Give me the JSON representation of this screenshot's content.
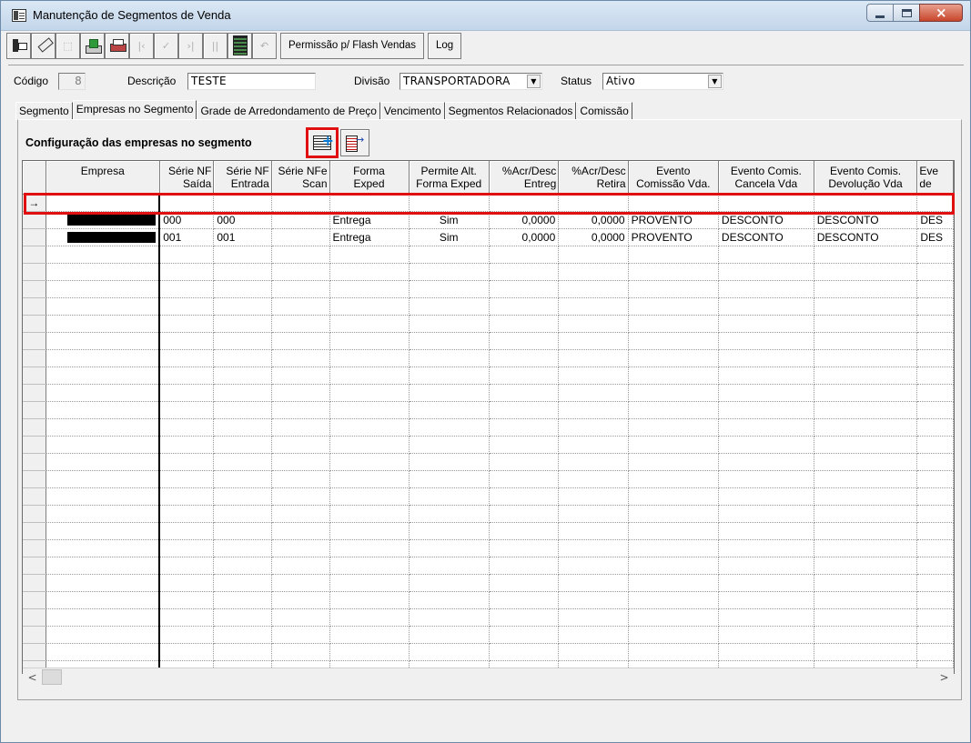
{
  "window": {
    "title": "Manutenção de Segmentos de Venda",
    "caption": {
      "minimize": "",
      "maximize": "",
      "close": "×"
    }
  },
  "toolbar": {
    "permissao_label": "Permissão p/ Flash Vendas",
    "log_label": "Log",
    "icons": [
      "exit-icon",
      "eraser-icon",
      "edit-icon",
      "save-icon",
      "print-icon",
      "first-icon",
      "confirm-icon",
      "last-icon",
      "pause-icon",
      "grid-icon",
      "undo-icon"
    ]
  },
  "form": {
    "codigo_label": "Código",
    "codigo_value": "8",
    "descricao_label": "Descrição",
    "descricao_value": "TESTE",
    "divisao_label": "Divisão",
    "divisao_value": "TRANSPORTADORA",
    "status_label": "Status",
    "status_value": "Ativo"
  },
  "tabs": [
    {
      "label": "Segmento",
      "active": false
    },
    {
      "label": "Empresas no Segmento",
      "active": true
    },
    {
      "label": "Grade de Arredondamento de Preço",
      "active": false
    },
    {
      "label": "Vencimento",
      "active": false
    },
    {
      "label": "Segmentos Relacionados",
      "active": false
    },
    {
      "label": "Comissão",
      "active": false
    }
  ],
  "panel": {
    "title": "Configuração das empresas no segmento"
  },
  "grid": {
    "columns": [
      {
        "l1": "Empresa",
        "l2": ""
      },
      {
        "l1": "Série NF",
        "l2": "Saída"
      },
      {
        "l1": "Série NF",
        "l2": "Entrada"
      },
      {
        "l1": "Série NFe",
        "l2": "Scan"
      },
      {
        "l1": "Forma",
        "l2": "Exped"
      },
      {
        "l1": "Permite Alt.",
        "l2": "Forma Exped"
      },
      {
        "l1": "%Acr/Desc",
        "l2": "Entreg"
      },
      {
        "l1": "%Acr/Desc",
        "l2": "Retira"
      },
      {
        "l1": "Evento",
        "l2": "Comissão Vda."
      },
      {
        "l1": "Evento Comis.",
        "l2": "Cancela Vda"
      },
      {
        "l1": "Evento Comis.",
        "l2": "Devolução Vda"
      },
      {
        "l1": "Eve",
        "l2": "de"
      }
    ],
    "indicator": "→",
    "rows": [
      {
        "serie_saida": "000",
        "serie_entrada": "000",
        "serie_scan": "",
        "forma": "Entrega",
        "permite": "Sim",
        "acr_entreg": "0,0000",
        "acr_retira": "0,0000",
        "evento_vda": "PROVENTO",
        "evento_cancela": "DESCONTO",
        "evento_devol": "DESCONTO",
        "evento_extra": "DES"
      },
      {
        "serie_saida": "001",
        "serie_entrada": "001",
        "serie_scan": "",
        "forma": "Entrega",
        "permite": "Sim",
        "acr_entreg": "0,0000",
        "acr_retira": "0,0000",
        "evento_vda": "PROVENTO",
        "evento_cancela": "DESCONTO",
        "evento_devol": "DESCONTO",
        "evento_extra": "DES"
      }
    ]
  },
  "scrollbar": {
    "left_arrow": "<",
    "right_arrow": ">"
  },
  "colors": {
    "highlight": "#e01010",
    "titlebar": "#c3d6ea",
    "close": "#c7452a"
  }
}
